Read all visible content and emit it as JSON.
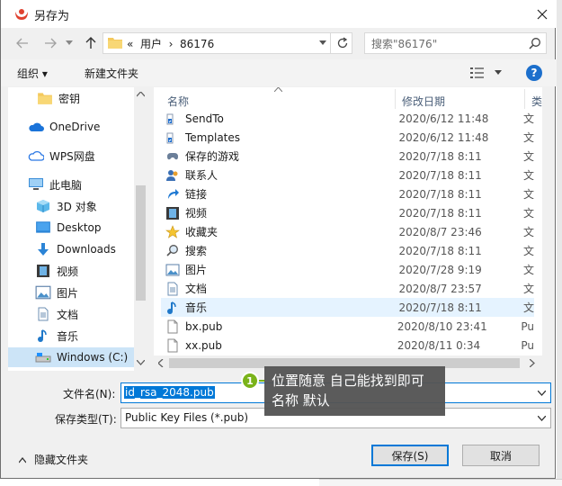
{
  "window": {
    "title": "另存为"
  },
  "address": {
    "path": "«  用户  ›  86176",
    "search_placeholder": "搜索\"86176\""
  },
  "toolbar": {
    "organize": "组织 ▾",
    "new_folder": "新建文件夹"
  },
  "nav": {
    "items": [
      {
        "label": "密钥",
        "icon": "folder-icon"
      },
      {
        "label": "OneDrive",
        "icon": "cloud-icon"
      },
      {
        "label": "WPS网盘",
        "icon": "cloud-outline-icon"
      },
      {
        "label": "此电脑",
        "icon": "computer-icon"
      },
      {
        "label": "3D 对象",
        "icon": "cube-icon"
      },
      {
        "label": "Desktop",
        "icon": "desktop-icon"
      },
      {
        "label": "Downloads",
        "icon": "download-icon"
      },
      {
        "label": "视频",
        "icon": "film-icon"
      },
      {
        "label": "图片",
        "icon": "picture-icon"
      },
      {
        "label": "文档",
        "icon": "document-icon"
      },
      {
        "label": "音乐",
        "icon": "music-icon"
      },
      {
        "label": "Windows (C:)",
        "icon": "drive-icon"
      }
    ]
  },
  "columns": {
    "name": "名称",
    "date": "修改日期",
    "type": "类"
  },
  "files": [
    {
      "name": "SendTo",
      "date": "2020/6/12 11:48",
      "type": "文",
      "icon": "shortcut-folder-icon"
    },
    {
      "name": "Templates",
      "date": "2020/6/12 11:48",
      "type": "文",
      "icon": "shortcut-folder-icon"
    },
    {
      "name": "保存的游戏",
      "date": "2020/7/18 8:11",
      "type": "文",
      "icon": "saved-games-icon"
    },
    {
      "name": "联系人",
      "date": "2020/7/18 8:11",
      "type": "文",
      "icon": "contacts-icon"
    },
    {
      "name": "链接",
      "date": "2020/7/18 8:11",
      "type": "文",
      "icon": "link-icon"
    },
    {
      "name": "视频",
      "date": "2020/7/18 8:11",
      "type": "文",
      "icon": "film-icon"
    },
    {
      "name": "收藏夹",
      "date": "2020/8/7 23:46",
      "type": "文",
      "icon": "star-icon"
    },
    {
      "name": "搜索",
      "date": "2020/7/18 8:11",
      "type": "文",
      "icon": "search-folder-icon"
    },
    {
      "name": "图片",
      "date": "2020/7/28 9:19",
      "type": "文",
      "icon": "picture-icon"
    },
    {
      "name": "文档",
      "date": "2020/8/7 23:57",
      "type": "文",
      "icon": "document-icon"
    },
    {
      "name": "音乐",
      "date": "2020/7/18 8:11",
      "type": "文",
      "icon": "music-icon"
    },
    {
      "name": "bx.pub",
      "date": "2020/8/10 23:41",
      "type": "Pu",
      "icon": "file-icon"
    },
    {
      "name": "xx.pub",
      "date": "2020/8/11 0:34",
      "type": "Pu",
      "icon": "file-icon"
    }
  ],
  "form": {
    "filename_label": "文件名(N):",
    "filename_value": "id_rsa_2048.pub",
    "filetype_label": "保存类型(T):",
    "filetype_value": "Public Key Files (*.pub)"
  },
  "footer": {
    "hide_folders": "隐藏文件夹",
    "save": "保存(S)",
    "cancel": "取消"
  },
  "annotation": {
    "badge": "1",
    "line1": "位置随意 自己能找到即可",
    "line2": "名称 默认"
  }
}
